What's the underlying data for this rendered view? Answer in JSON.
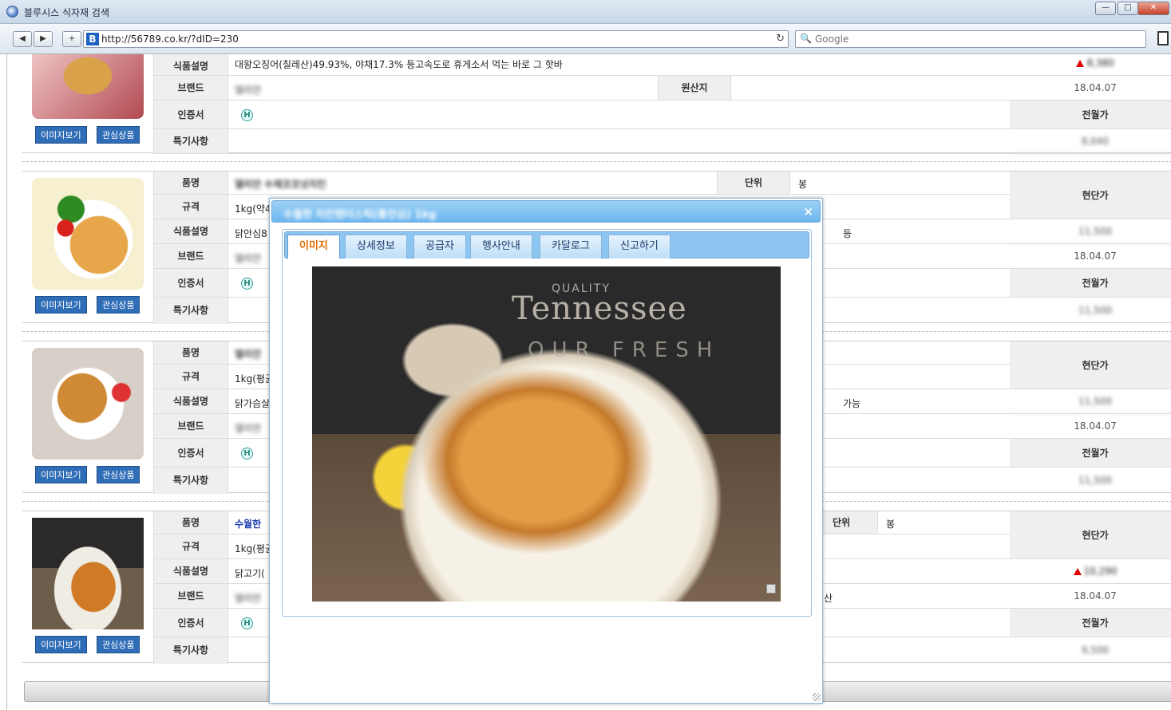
{
  "window": {
    "title": "블루시스 식자재 검색",
    "url": "http://56789.co.kr/?dID=230",
    "search_placeholder": "Google"
  },
  "labels": {
    "name": "품명",
    "spec": "규격",
    "desc": "식품설명",
    "brand": "브랜드",
    "cert": "인증서",
    "notes": "특기사항",
    "unit": "단위",
    "origin": "원산지",
    "current_price": "현단가",
    "prev_month": "전월가",
    "image_btn": "이미지보기",
    "fav_btn": "관심상품",
    "cert_mark": "H"
  },
  "products": [
    {
      "desc": "대왕오징어(칠레산)49.93%, 야채17.3% 등고속도로 휴게소서 먹는 바로 그 핫바",
      "brand": "델리안",
      "price": "8,380",
      "date": "18.04.07",
      "prev_price": "8,040"
    },
    {
      "name": "델리안 수제코코넛치킨",
      "spec": "1kg(약4",
      "desc": "닭안심8",
      "desc_tail": "등",
      "brand": "델리안",
      "unit_value": "봉",
      "price": "11,500",
      "date": "18.04.07",
      "prev_price": "11,500"
    },
    {
      "name": "델리안",
      "spec": "1kg(평균",
      "desc": "닭가슴살",
      "desc_tail": "가능",
      "brand": "델리안",
      "price": "11,500",
      "date": "18.04.07",
      "prev_price": "11,500"
    },
    {
      "name": "수월한",
      "spec": "1kg(평균",
      "desc": "닭고기(",
      "brand_tail": "산",
      "brand": "델리안",
      "unit_value": "봉",
      "price": "10,290",
      "date": "18.04.07",
      "prev_price": "9,500"
    }
  ],
  "modal": {
    "title": "수월한 치킨텐더스틱(통안심) 1kg",
    "close": "×",
    "tabs": [
      "이미지",
      "상세정보",
      "공급자",
      "행사안내",
      "카달로그",
      "신고하기"
    ],
    "photo_text_top": "QUALITY",
    "photo_text_main": "Tennessee",
    "photo_text_sub": "OUR FRESH"
  }
}
